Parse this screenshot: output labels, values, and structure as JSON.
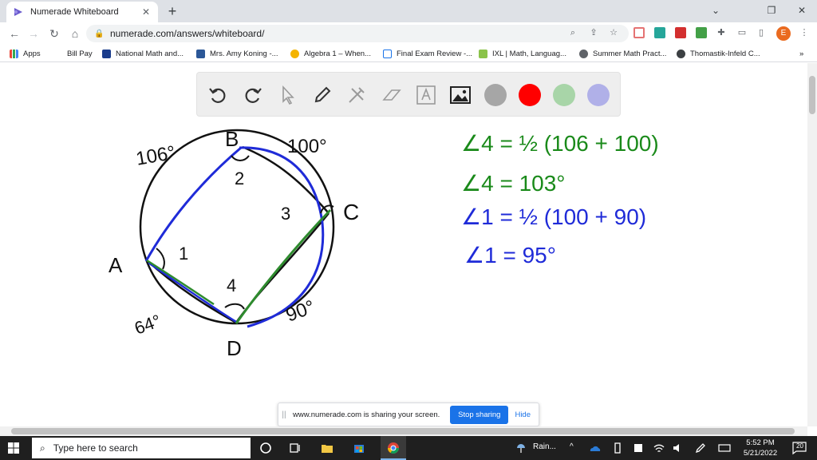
{
  "browser": {
    "tab_title": "Numerade Whiteboard",
    "tab_close": "✕",
    "new_tab": "+",
    "url": "numerade.com/answers/whiteboard/",
    "profile_initial": "E",
    "window_controls": {
      "minimize": "⌄",
      "restore": "❐",
      "close": "✕"
    }
  },
  "bookmarks": [
    {
      "label": "Apps",
      "color": "#4285f4"
    },
    {
      "label": "Bill Pay",
      "color": "#ffffff"
    },
    {
      "label": "National Math and...",
      "color": "#1a3c8c"
    },
    {
      "label": "Mrs. Amy Koning -...",
      "color": "#2b5797"
    },
    {
      "label": "Algebra 1 – When...",
      "color": "#f4b400"
    },
    {
      "label": "Final Exam Review -...",
      "color": "#1a73e8"
    },
    {
      "label": "IXL | Math, Languag...",
      "color": "#8bc34a"
    },
    {
      "label": "Summer Math Pract...",
      "color": "#5f6368"
    },
    {
      "label": "Thomastik-Infeld C...",
      "color": "#3c4043"
    }
  ],
  "bookmarks_more": "»",
  "whiteboard": {
    "tools": [
      "undo-icon",
      "redo-icon",
      "cursor-icon",
      "pencil-icon",
      "tools-icon",
      "eraser-icon",
      "text-icon",
      "image-icon"
    ],
    "colors": [
      "#a6a6a6",
      "#ff0000",
      "#a8d5a8",
      "#b0b0e8"
    ],
    "diagram_labels": {
      "B": "B",
      "C": "C",
      "A": "A",
      "D": "D",
      "arc_ab": "106°",
      "arc_bc": "100°",
      "arc_cd": "90°",
      "arc_da": "64°",
      "angle1": "1",
      "angle2": "2",
      "angle3": "3",
      "angle4": "4"
    },
    "equations": [
      "∠4 = ½ (106 + 100)",
      "∠4 = 103°",
      "∠1 = ½ (100 + 90)",
      "∠1 = 95°"
    ]
  },
  "sharing_bar": {
    "grip": "||",
    "message": "www.numerade.com is sharing your screen.",
    "stop_label": "Stop sharing",
    "hide_label": "Hide"
  },
  "taskbar": {
    "search_placeholder": "Type here to search",
    "weather": "Rain...",
    "time": "5:52 PM",
    "date": "5/21/2022",
    "notifications": "20"
  }
}
